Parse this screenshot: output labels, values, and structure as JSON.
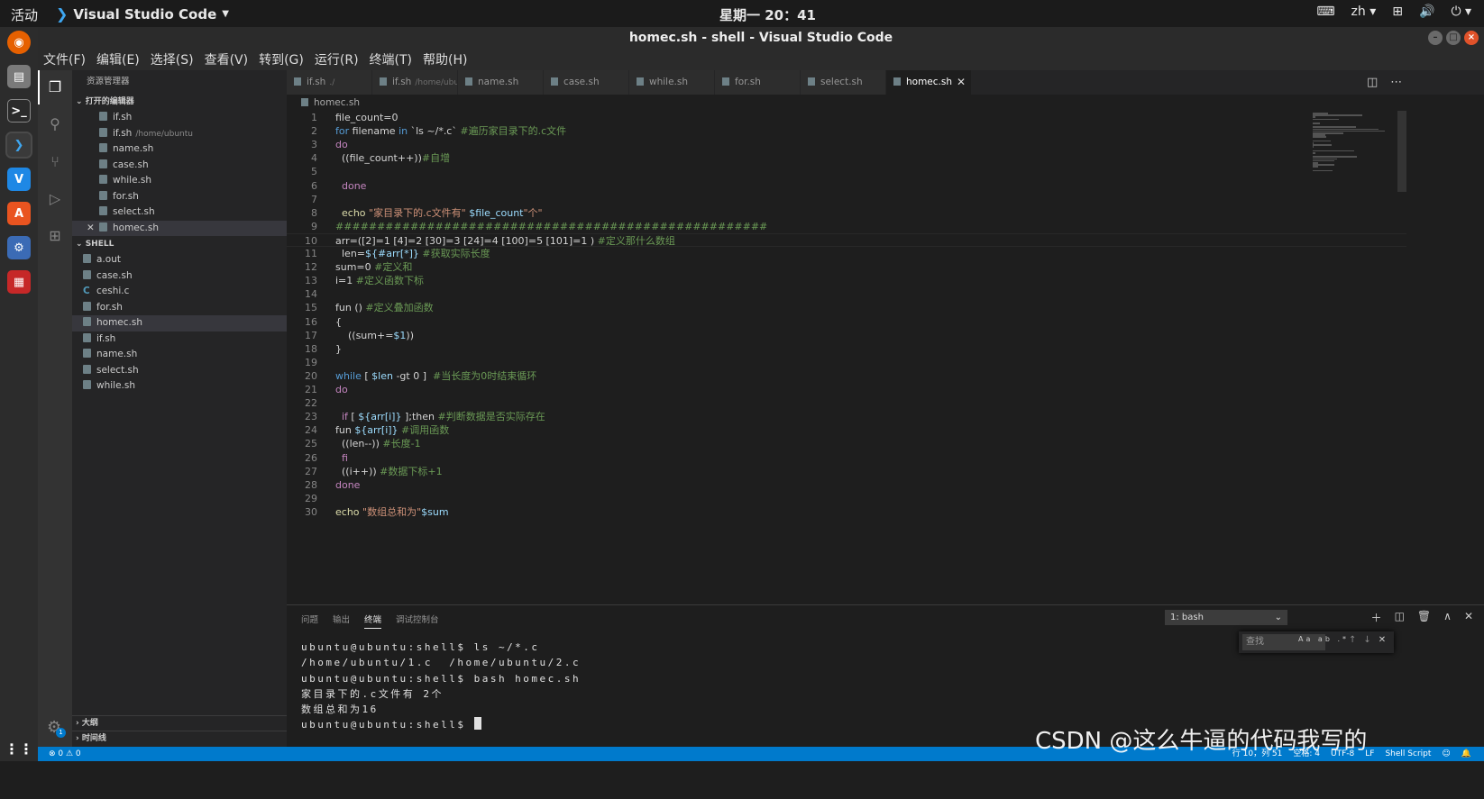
{
  "system": {
    "activities": "活动",
    "app_name": "Visual Studio Code",
    "clock": "星期一 20：41",
    "lang": "zh"
  },
  "window": {
    "title": "homec.sh - shell - Visual Studio Code"
  },
  "menu": [
    "文件(F)",
    "编辑(E)",
    "选择(S)",
    "查看(V)",
    "转到(G)",
    "运行(R)",
    "终端(T)",
    "帮助(H)"
  ],
  "sidebar": {
    "title": "资源管理器",
    "open_editors_label": "打开的编辑器",
    "open_editors": [
      {
        "name": "if.sh",
        "desc": ""
      },
      {
        "name": "if.sh",
        "desc": "/home/ubuntu"
      },
      {
        "name": "name.sh",
        "desc": ""
      },
      {
        "name": "case.sh",
        "desc": ""
      },
      {
        "name": "while.sh",
        "desc": ""
      },
      {
        "name": "for.sh",
        "desc": ""
      },
      {
        "name": "select.sh",
        "desc": ""
      },
      {
        "name": "homec.sh",
        "desc": ""
      }
    ],
    "folder_label": "SHELL",
    "files": [
      "a.out",
      "case.sh",
      "ceshi.c",
      "for.sh",
      "homec.sh",
      "if.sh",
      "name.sh",
      "select.sh",
      "while.sh"
    ],
    "outline_label": "大纲",
    "timeline_label": "时间线"
  },
  "tabs": [
    {
      "name": "if.sh",
      "desc": "./"
    },
    {
      "name": "if.sh",
      "desc": "/home/ubuntu"
    },
    {
      "name": "name.sh",
      "desc": ""
    },
    {
      "name": "case.sh",
      "desc": ""
    },
    {
      "name": "while.sh",
      "desc": ""
    },
    {
      "name": "for.sh",
      "desc": ""
    },
    {
      "name": "select.sh",
      "desc": ""
    },
    {
      "name": "homec.sh",
      "desc": "",
      "active": true
    }
  ],
  "breadcrumb": "homec.sh",
  "editor": {
    "cursor_line": 10,
    "lines": [
      "file_count=0",
      "for filename in `ls ~/*.c` #遍历家目录下的.c文件",
      "do",
      "  ((file_count++))#自增",
      "",
      "  done",
      "",
      "  echo \"家目录下的.c文件有\" $file_count\"个\"",
      "####################################################",
      "arr=([2]=1 [4]=2 [30]=3 [24]=4 [100]=5 [101]=1 ) #定义那什么数组",
      "  len=${#arr[*]} #获取实际长度",
      "sum=0 #定义和",
      "i=1 #定义函数下标",
      "",
      "fun () #定义叠加函数",
      "{",
      "    ((sum+=$1))",
      "}",
      "",
      "while [ $len -gt 0 ]  #当长度为0时结束循环",
      "do",
      "",
      "  if [ ${arr[i]} ];then #判断数据是否实际存在",
      "fun ${arr[i]} #调用函数",
      "  ((len--)) #长度-1",
      "  fi",
      "  ((i++)) #数据下标+1",
      "done",
      "",
      "echo \"数组总和为\"$sum"
    ]
  },
  "panel": {
    "tabs": [
      "问题",
      "输出",
      "终端",
      "调试控制台"
    ],
    "active_tab": "终端",
    "terminal_select": "1: bash",
    "find_placeholder": "查找",
    "terminal_lines": [
      "ubuntu@ubuntu:shell$ ls ~/*.c",
      "/home/ubuntu/1.c  /home/ubuntu/2.c",
      "ubuntu@ubuntu:shell$ bash homec.sh",
      "家目录下的.c文件有 2个",
      "数组总和为16",
      "ubuntu@ubuntu:shell$ "
    ]
  },
  "statusbar": {
    "problems": "⊗ 0 ⚠ 0",
    "position": "行 10，列 51",
    "spaces": "空格: 4",
    "encoding": "UTF-8",
    "eol": "LF",
    "language": "Shell Script"
  },
  "watermark": "CSDN @这么牛逼的代码我写的",
  "colors": {
    "accent": "#007acc",
    "editor_bg": "#1e1e1e",
    "sidebar_bg": "#252526",
    "activity_bg": "#333333"
  }
}
